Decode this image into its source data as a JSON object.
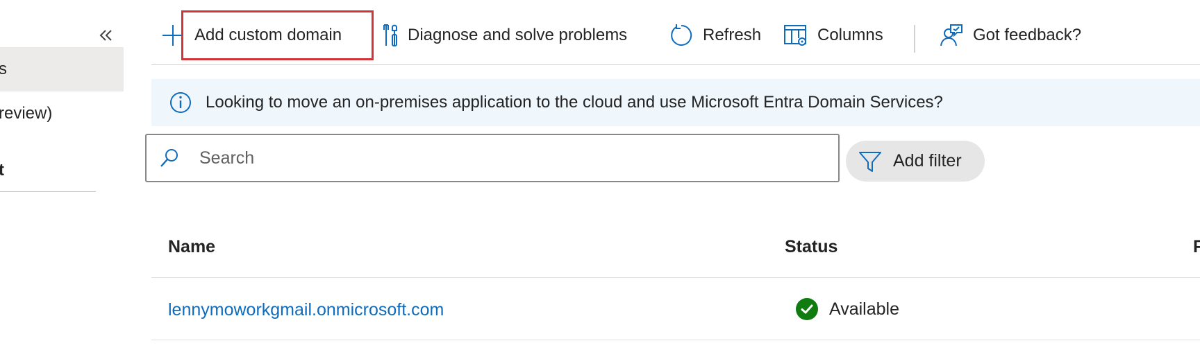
{
  "sidebar": {
    "active_item": "s",
    "preview_item": "review)",
    "section_item": "t"
  },
  "toolbar": {
    "add_domain_label": "Add custom domain",
    "diagnose_label": "Diagnose and solve problems",
    "refresh_label": "Refresh",
    "columns_label": "Columns",
    "feedback_label": "Got feedback?"
  },
  "banner": {
    "text": "Looking to move an on-premises application to the cloud and use Microsoft Entra Domain Services?"
  },
  "search": {
    "placeholder": "Search",
    "value": ""
  },
  "filter": {
    "label": "Add filter"
  },
  "table": {
    "columns": [
      "Name",
      "Status",
      "F"
    ],
    "rows": [
      {
        "name": "lennymoworkgmail.onmicrosoft.com",
        "status": "Available"
      }
    ]
  },
  "colors": {
    "accent": "#0f6cbd",
    "highlight": "#d13438",
    "success": "#107c10",
    "banner_bg": "#eff6fc",
    "nav_active_bg": "#edebe9"
  },
  "icons": {
    "collapse": "double-chevron-left-icon",
    "add": "plus-icon",
    "diagnose": "wrench-icon",
    "refresh": "refresh-icon",
    "columns": "columns-settings-icon",
    "feedback": "feedback-person-icon",
    "info": "info-icon",
    "search": "search-icon",
    "filter": "filter-icon",
    "status": "checkmark-circle-icon"
  }
}
